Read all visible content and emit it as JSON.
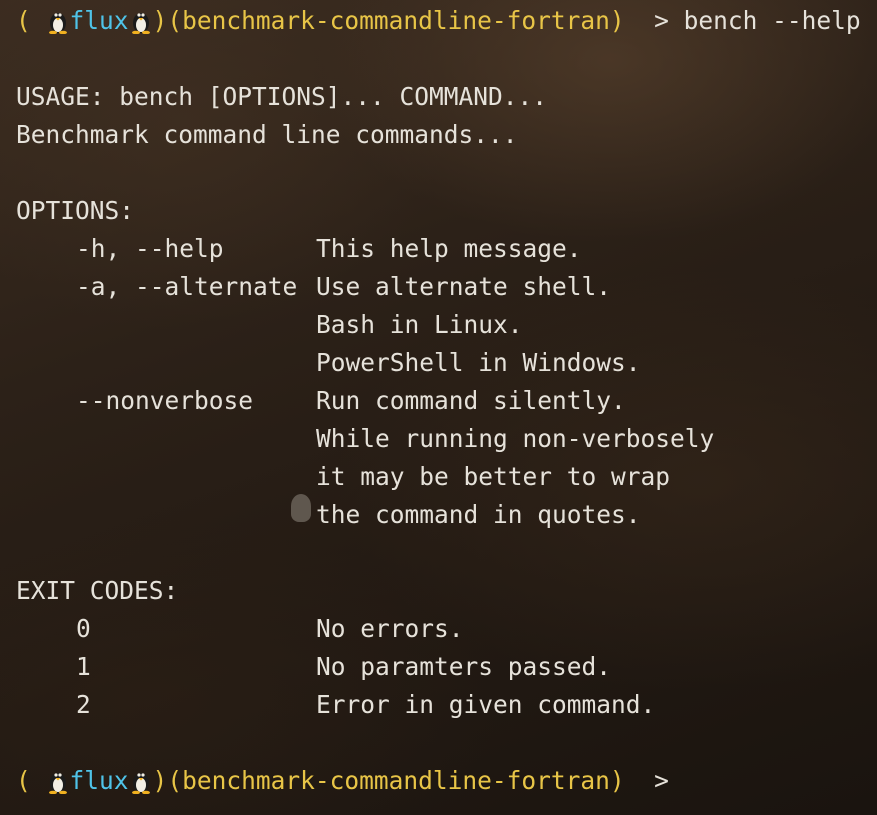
{
  "prompt": {
    "open": "(",
    "user": "flux",
    "close": ")",
    "directory": "(benchmark-commandline-fortran)",
    "arrow": ">",
    "command": "bench --help"
  },
  "usage": "USAGE: bench [OPTIONS]... COMMAND...",
  "description": "Benchmark command line commands...",
  "options": {
    "header": "OPTIONS:",
    "items": [
      {
        "flag": "-h, --help",
        "text": "This help message."
      },
      {
        "flag": "-a, --alternate",
        "text": "Use alternate shell."
      },
      {
        "flag": "",
        "text": "Bash in Linux."
      },
      {
        "flag": "",
        "text": "PowerShell in Windows."
      },
      {
        "flag": "--nonverbose",
        "text": "Run command silently."
      },
      {
        "flag": "",
        "text": "While running non-verbosely"
      },
      {
        "flag": "",
        "text": "it may be better to wrap"
      },
      {
        "flag": "",
        "text": "the command in quotes."
      }
    ]
  },
  "exit_codes": {
    "header": "EXIT CODES:",
    "items": [
      {
        "code": "0",
        "text": "No errors."
      },
      {
        "code": "1",
        "text": "No paramters passed."
      },
      {
        "code": "2",
        "text": "Error in given command."
      }
    ]
  },
  "colors": {
    "prompt_yellow": "#e8c547",
    "user_cyan": "#4fc3e8",
    "text": "#e6e2da"
  },
  "icons": [
    "tux-penguin-icon"
  ]
}
